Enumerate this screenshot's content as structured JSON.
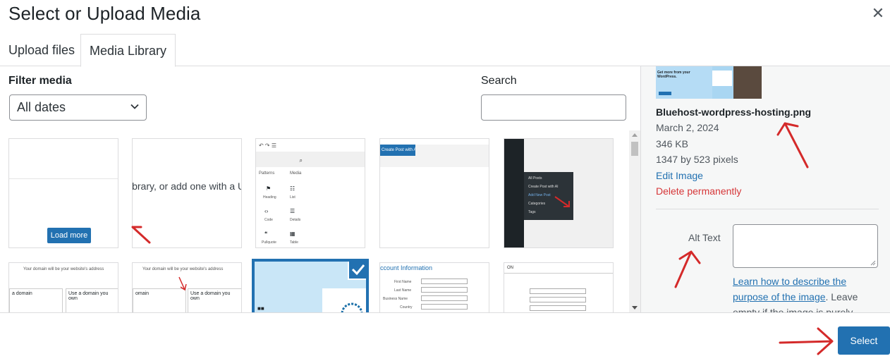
{
  "modal": {
    "title": "Select or Upload Media",
    "close_icon": "close-icon"
  },
  "tabs": [
    {
      "label": "Upload files",
      "active": false
    },
    {
      "label": "Media Library",
      "active": true
    }
  ],
  "filters": {
    "label": "Filter media",
    "date_selected": "All dates",
    "search_label": "Search",
    "search_value": ""
  },
  "grid": {
    "thumbs": [
      {
        "kind": "load-more",
        "button_label": "Load more"
      },
      {
        "kind": "text-snippet",
        "text": "ibrary, or add one with a U"
      },
      {
        "kind": "block-inserter",
        "labels": [
          "Patterns",
          "Media",
          "Heading",
          "List",
          "Code",
          "Details",
          "Pullquote",
          "Table"
        ]
      },
      {
        "kind": "ai-button",
        "text": "Create Post with AI"
      },
      {
        "kind": "posts-menu",
        "items": [
          "All Posts",
          "Create Post with AI",
          "Add New Post",
          "Categories",
          "Tags"
        ]
      },
      {
        "kind": "domain-form",
        "heading": "Your domain will be your website's address",
        "left_col": "a domain",
        "right_col": "Use a domain you own"
      },
      {
        "kind": "domain-form",
        "heading": "Your domain will be your website's address",
        "left_col": "omain",
        "right_col": "Use a domain you own"
      },
      {
        "kind": "selected-hosting",
        "selected": true
      },
      {
        "kind": "account-form",
        "heading": "ccount Information",
        "fields": [
          "First Name",
          "Last Name",
          "Business Name",
          "Country"
        ]
      },
      {
        "kind": "table-screen",
        "text": "ON"
      }
    ]
  },
  "details": {
    "file_name": "Bluehost-wordpress-hosting.png",
    "date": "March 2, 2024",
    "size": "346 KB",
    "dimensions": "1347 by 523 pixels",
    "edit_label": "Edit Image",
    "delete_label": "Delete permanently",
    "thumb_text": "Get more from your WordPress.",
    "alt_label": "Alt Text",
    "alt_value": "",
    "help_link": "Learn how to describe the purpose of the image",
    "help_rest": ". Leave empty if the image is purely decorative."
  },
  "toolbar": {
    "select_label": "Select"
  },
  "colors": {
    "accent": "#2271b1",
    "danger": "#d63638",
    "annotation": "#d42a2a"
  }
}
